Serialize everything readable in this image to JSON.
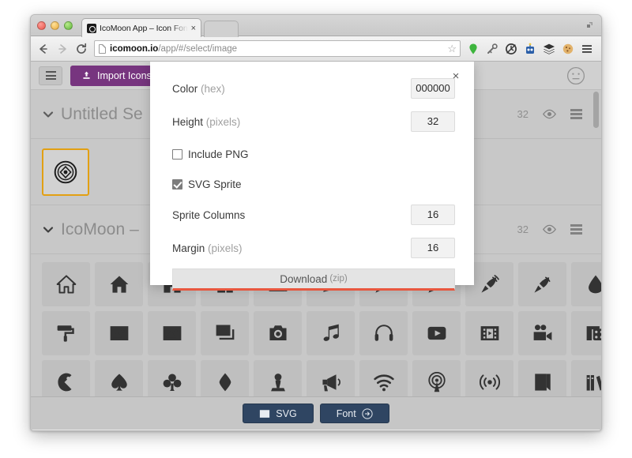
{
  "browser": {
    "tab": {
      "title": "IcoMoon App – Icon Font G",
      "close_label": "×"
    },
    "url": {
      "host": "icomoon.io",
      "path": "/app/#/select/image"
    },
    "nav": {
      "back": "back-arrow",
      "forward": "forward-arrow",
      "reload": "reload"
    },
    "extensions": [
      "pin-icon",
      "key-icon",
      "clock-icon",
      "robot-icon",
      "layers-icon",
      "cookie-icon",
      "menu-icon"
    ],
    "bookmark_star": "☆"
  },
  "app": {
    "topbar": {
      "menu_toggle": "hamburger-icon",
      "import_label": "Import Icons",
      "import_icon": "upload-icon",
      "import_color": "#77357f",
      "smiley": "neutral-face-icon"
    },
    "sets": [
      {
        "title": "Untitled Se",
        "count": "32",
        "eye": "eye-icon",
        "menu": "list-icon"
      },
      {
        "title": "IcoMoon –",
        "count": "32",
        "eye": "eye-icon",
        "menu": "list-icon"
      }
    ],
    "selection": {
      "tile_icon": "icomoon-logo-icon",
      "highlight_color": "#e2a013"
    },
    "grid": {
      "row1": [
        "home-outline-icon",
        "home-filled-icon",
        "home-icon-3",
        "office-icon",
        "newspaper-icon",
        "pencil-icon",
        "pen-icon",
        "quill-icon",
        "pen-nib-icon",
        "feather-icon",
        "droplet-icon"
      ],
      "row2": [
        "paint-roller-icon",
        "image-icon",
        "image-2-icon",
        "images-icon",
        "camera-icon",
        "music-icon",
        "headphones-icon",
        "play-icon",
        "film-icon",
        "video-camera-icon",
        "dice-icon"
      ],
      "row3": [
        "pacman-icon",
        "spades-icon",
        "clubs-icon",
        "diamonds-icon",
        "chess-pawn-icon",
        "bullhorn-icon",
        "wifi-icon",
        "broadcast-icon",
        "podcast-icon",
        "book-icon",
        "books-icon"
      ]
    },
    "bottombar": {
      "svg_label": "SVG",
      "svg_icon": "image-icon",
      "font_label": "Font",
      "font_icon": "arrow-right-circle-icon"
    }
  },
  "dialog": {
    "close": "×",
    "rows": [
      {
        "label": "Color",
        "hint": "(hex)",
        "value": "000000"
      },
      {
        "label": "Height",
        "hint": "(pixels)",
        "value": "32"
      }
    ],
    "checkboxes": [
      {
        "label": "Include PNG",
        "checked": false
      },
      {
        "label": "SVG Sprite",
        "checked": true
      }
    ],
    "rows2": [
      {
        "label": "Sprite Columns",
        "hint": "",
        "value": "16"
      },
      {
        "label": "Margin",
        "hint": "(pixels)",
        "value": "16"
      }
    ],
    "download": {
      "label": "Download",
      "hint": "(zip)",
      "accent": "#e8573f"
    }
  }
}
